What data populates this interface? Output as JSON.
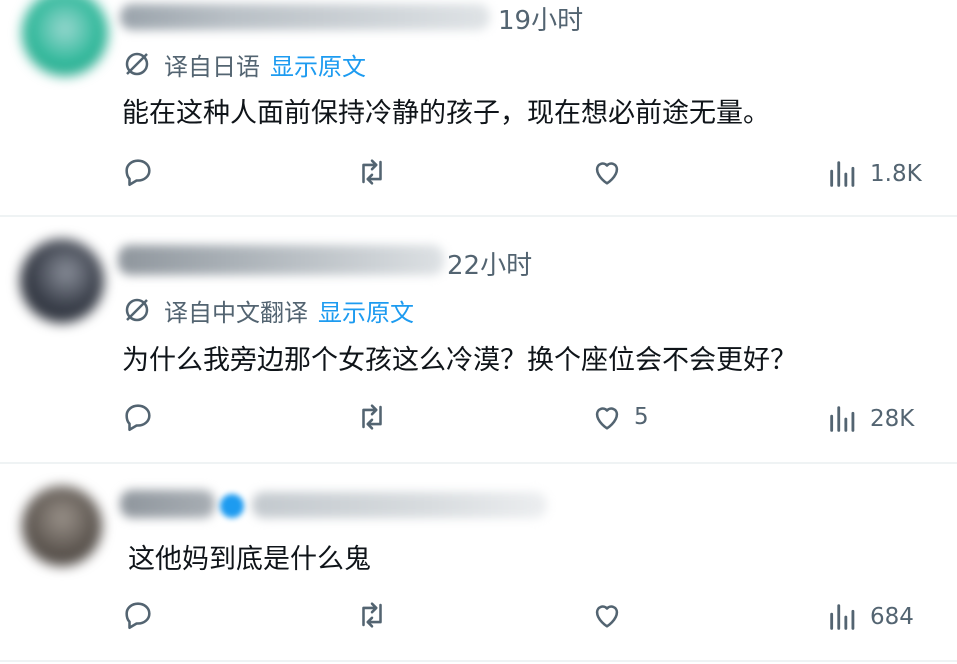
{
  "tweets": [
    {
      "time": "19小时",
      "translation": {
        "label": "译自日语",
        "link": "显示原文"
      },
      "text": "能在这种人面前保持冷静的孩子，现在想必前途无量。",
      "actions": {
        "reply": "",
        "retweet": "",
        "like": "",
        "views": "1.8K"
      }
    },
    {
      "time": "22小时",
      "translation": {
        "label": "译自中文翻译",
        "link": "显示原文"
      },
      "text": "为什么我旁边那个女孩这么冷漠？换个座位会不会更好？",
      "actions": {
        "reply": "",
        "retweet": "",
        "like": "5",
        "views": "28K"
      }
    },
    {
      "time": "",
      "translation": null,
      "text": "这他妈到底是什么鬼",
      "actions": {
        "reply": "",
        "retweet": "",
        "like": "",
        "views": "684"
      }
    }
  ],
  "colors": {
    "text": "#0f1419",
    "muted": "#536471",
    "link": "#1d9bf0",
    "divider": "#eff3f4"
  },
  "icons": [
    "translate-icon",
    "reply-icon",
    "retweet-icon",
    "like-icon",
    "views-icon"
  ]
}
